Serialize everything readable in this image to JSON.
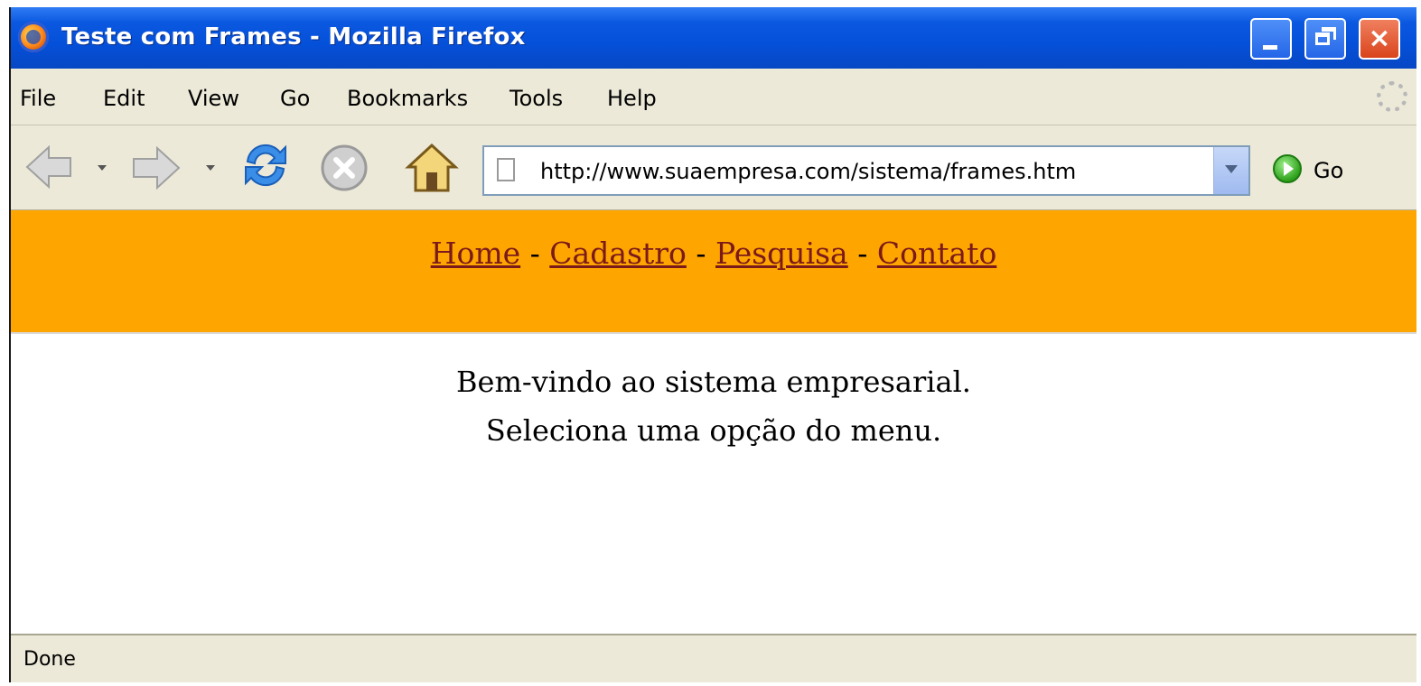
{
  "window": {
    "title": "Teste com Frames - Mozilla Firefox",
    "controls": {
      "minimize": "minimize",
      "maximize": "restore",
      "close": "×"
    }
  },
  "menu": {
    "items": [
      "File",
      "Edit",
      "View",
      "Go",
      "Bookmarks",
      "Tools",
      "Help"
    ]
  },
  "toolbar": {
    "url": "http://www.suaempresa.com/sistema/frames.htm",
    "go_label": "Go",
    "icons": [
      "back-icon",
      "forward-icon",
      "reload-icon",
      "stop-icon",
      "home-icon",
      "page-icon",
      "go-icon"
    ]
  },
  "top_frame": {
    "background": "#ffa500",
    "links": [
      "Home",
      "Cadastro",
      "Pesquisa",
      "Contato"
    ],
    "separator": " - "
  },
  "main_frame": {
    "line1": "Bem-vindo ao sistema empresarial.",
    "line2": "Seleciona uma opção do menu."
  },
  "status": {
    "text": "Done"
  },
  "colors": {
    "titlebar": "#0550d9",
    "chrome": "#ece9d8",
    "link": "#7a1a1a"
  }
}
